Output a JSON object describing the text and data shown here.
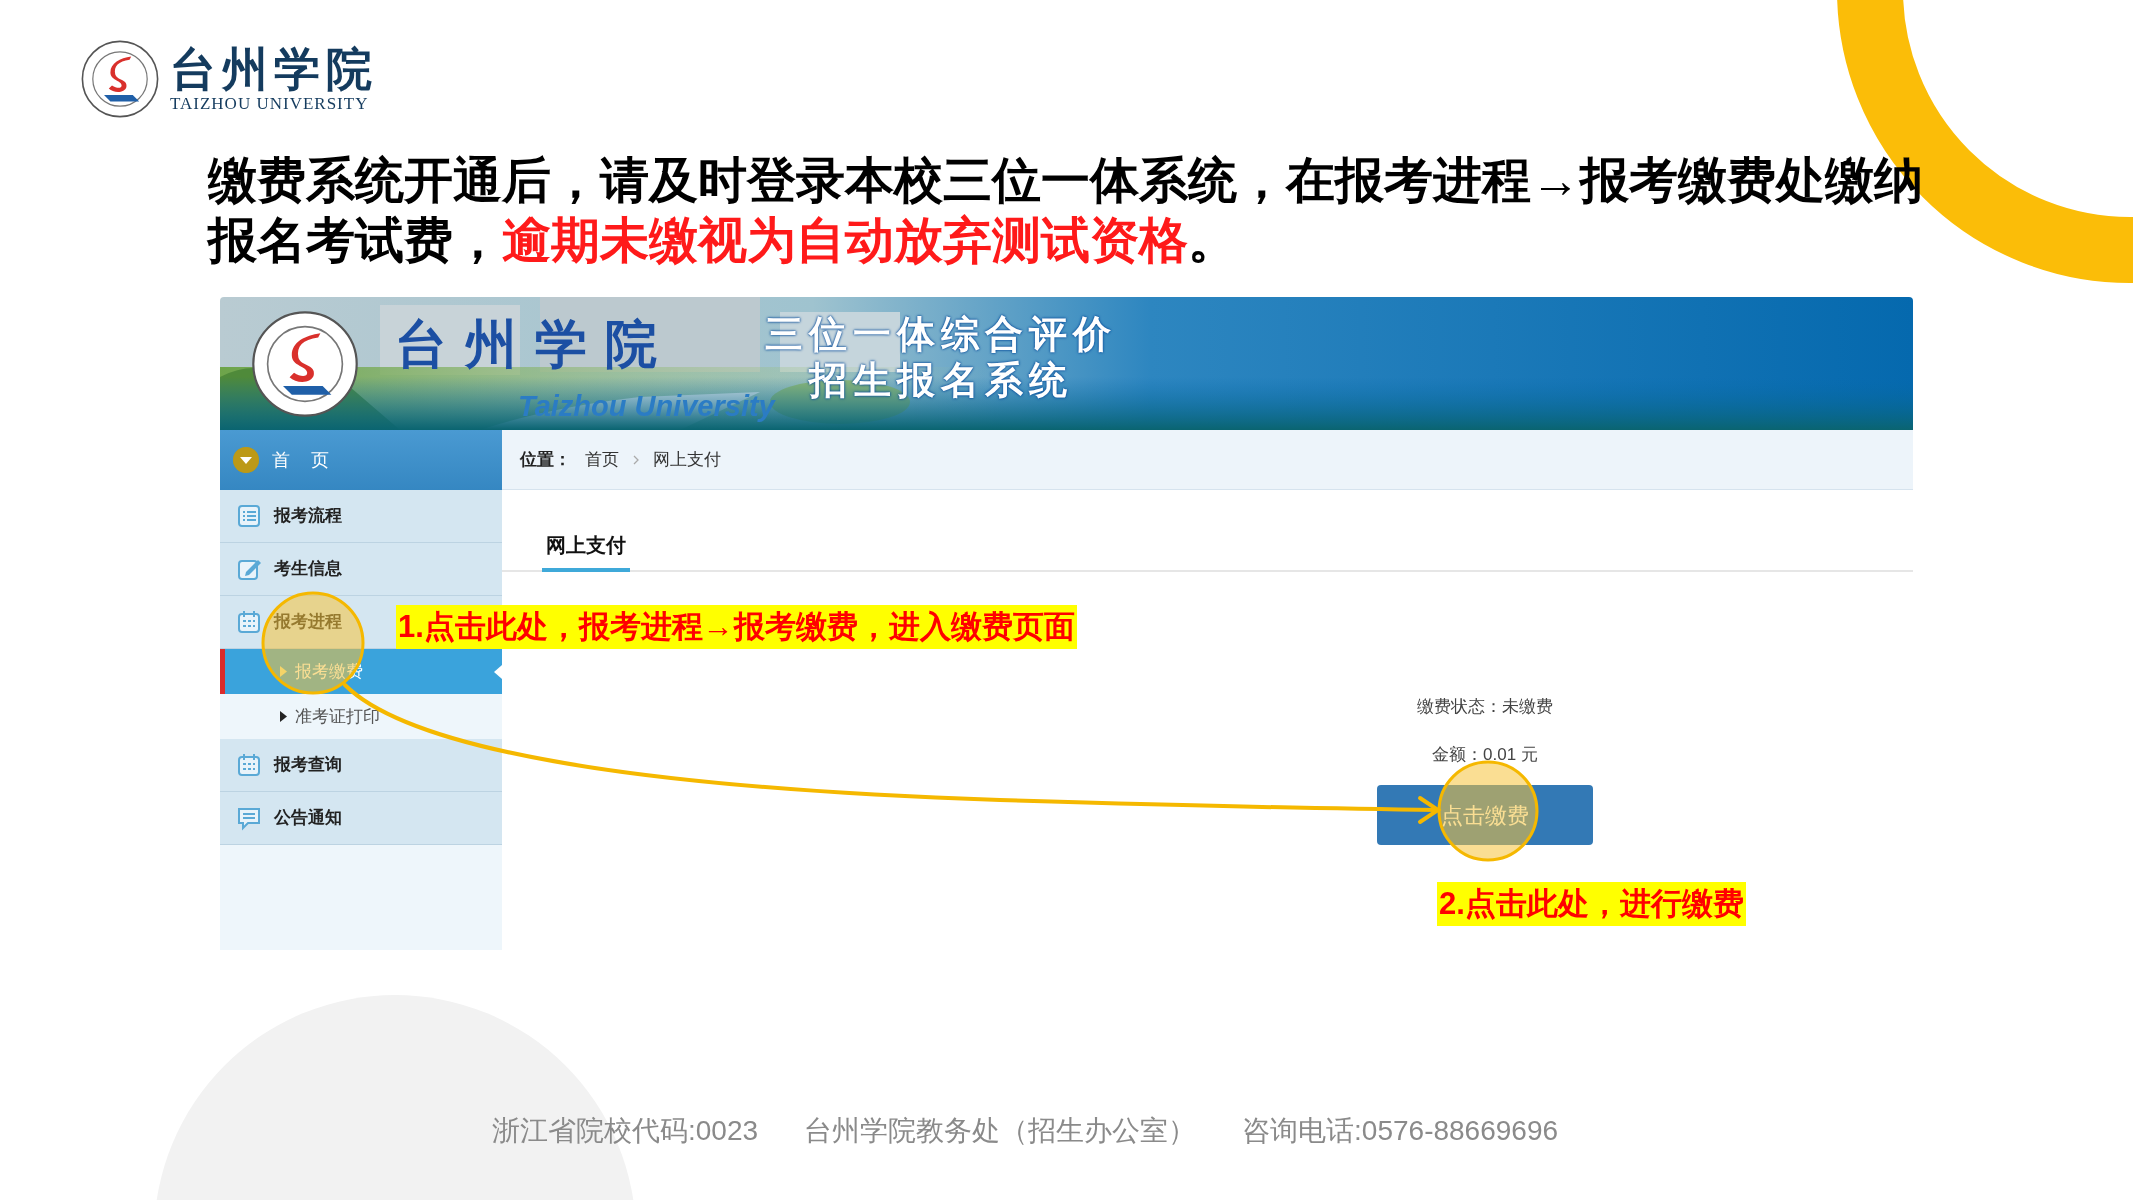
{
  "slide_logo": {
    "name": "台州学院",
    "subtitle": "TAIZHOU UNIVERSITY"
  },
  "heading": {
    "lines": [
      [
        {
          "text": "缴费系统开通后，请及时登录本校三位一体系统，在报考进程→报考缴费处缴纳",
          "emphasis": false
        }
      ],
      [
        {
          "text": "报名考试费，",
          "emphasis": false
        },
        {
          "text": "逾期未缴视为自动放弃测试资格",
          "emphasis": true
        },
        {
          "text": "。",
          "emphasis": false
        }
      ]
    ]
  },
  "site": {
    "banner": {
      "title": "台州学院",
      "subtitle": "Taizhou University",
      "system_title_lines": [
        "三位一体综合评价",
        "招生报名系统"
      ]
    },
    "nav_header": "首 页",
    "sidebar": {
      "items": [
        {
          "label": "报考流程",
          "selected": false
        },
        {
          "label": "考生信息",
          "selected": false
        },
        {
          "label": "报考进程",
          "selected": false,
          "expanded": true,
          "children": [
            {
              "label": "报考缴费",
              "selected": true
            },
            {
              "label": "准考证打印",
              "selected": false
            }
          ]
        },
        {
          "label": "报考查询",
          "selected": false
        },
        {
          "label": "公告通知",
          "selected": false
        }
      ]
    },
    "breadcrumb": {
      "label": "位置：",
      "items": [
        "首页",
        "网上支付"
      ]
    },
    "tabs": [
      {
        "label": "网上支付",
        "selected": true
      }
    ],
    "payment": {
      "status": "缴费状态：未缴费",
      "amount": "金额：0.01 元",
      "button": "点击缴费"
    }
  },
  "annotations": [
    {
      "text": "1.点击此处，报考进程→报考缴费，进入缴费页面"
    },
    {
      "text": "2.点击此处，进行缴费"
    }
  ],
  "footer": [
    "浙江省院校代码:0023",
    "台州学院教务处（招生办公室）",
    "咨询电话:0576-88669696"
  ]
}
